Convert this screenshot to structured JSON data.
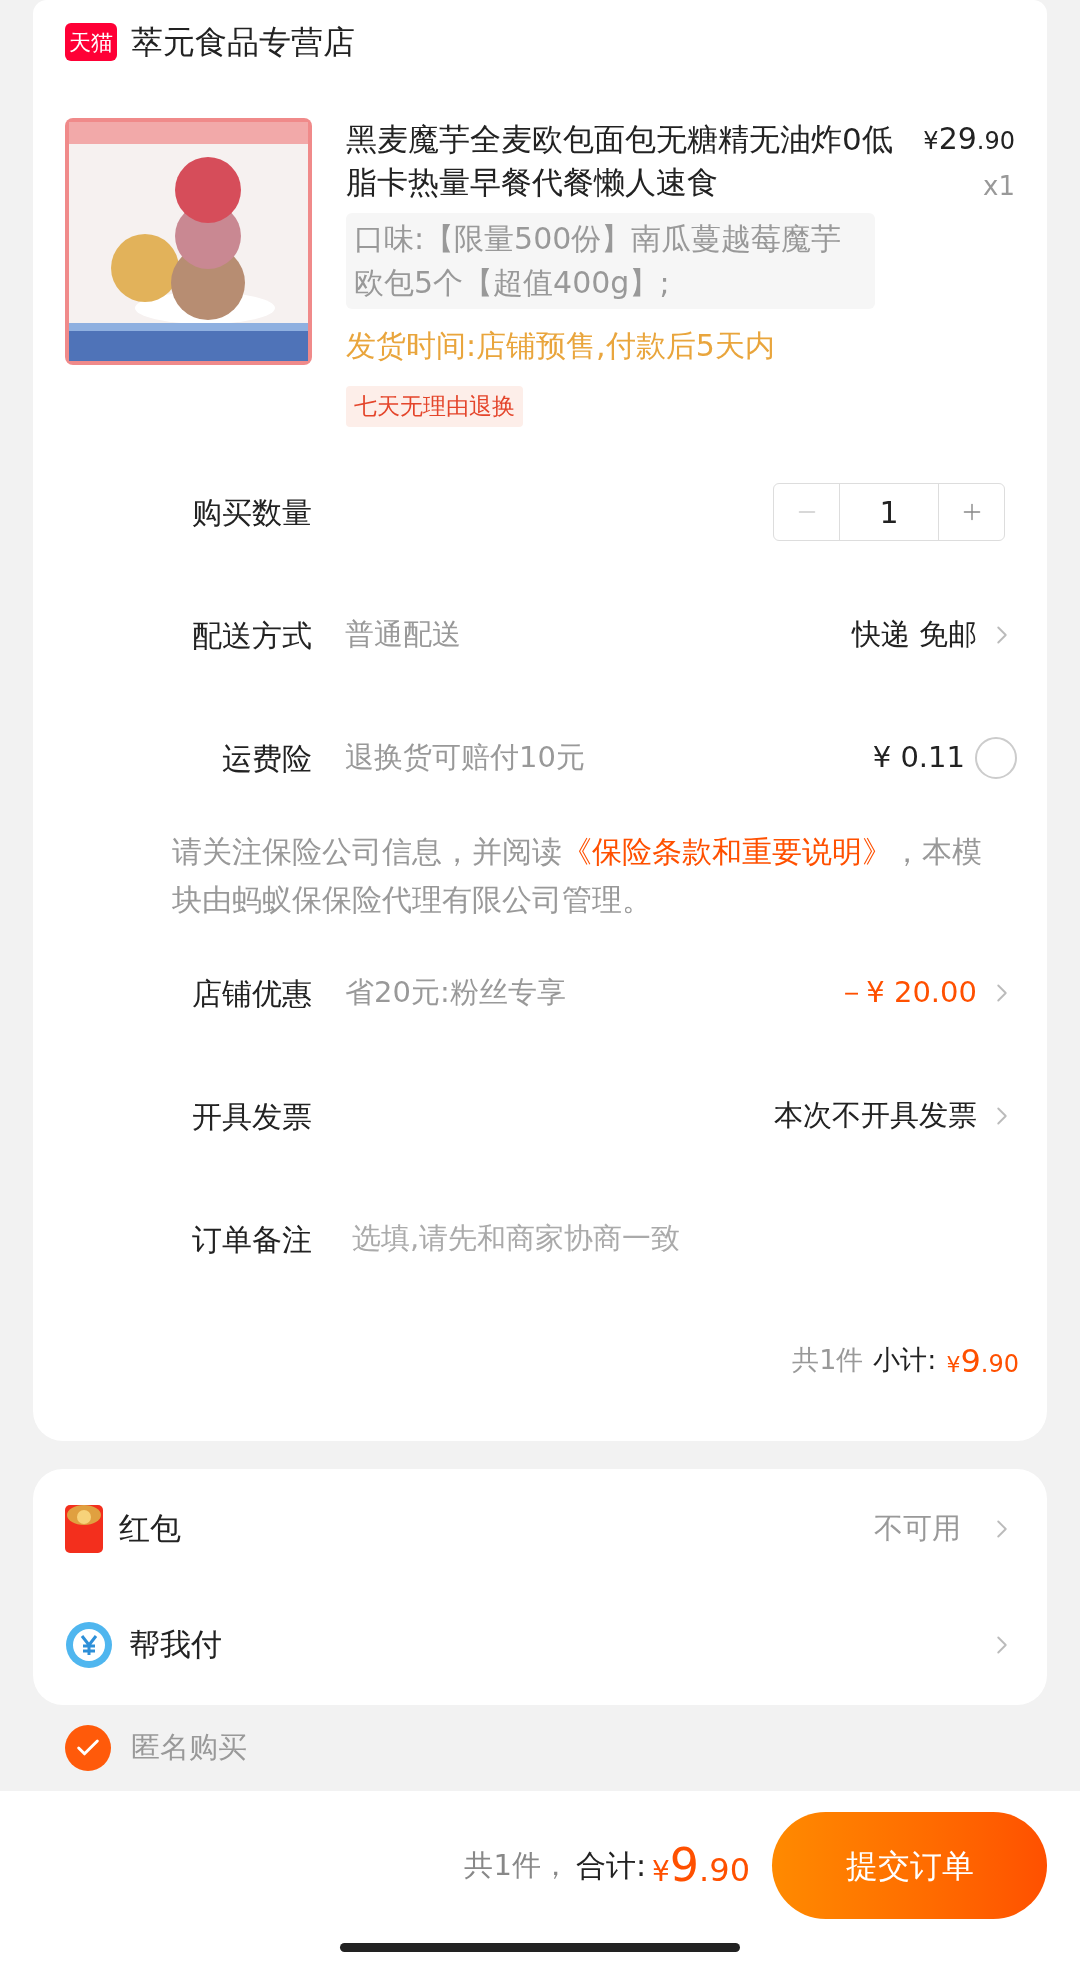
{
  "store": {
    "badge": "天猫",
    "name": "萃元食品专营店"
  },
  "product": {
    "title": "黑麦魔芋全麦欧包面包无糖精无油炸0低脂卡热量早餐代餐懒人速食",
    "price_symbol": "¥",
    "price_int": "29",
    "price_dec": ".90",
    "quantity": "x1",
    "spec": "口味:【限量500份】南瓜蔓越莓魔芋欧包5个【超值400g】;",
    "shipping_time": "发货时间:店铺预售,付款后5天内",
    "tag": "七天无理由退换"
  },
  "quantity_row": {
    "label": "购买数量",
    "value": "1",
    "minus_disabled": true
  },
  "delivery": {
    "label": "配送方式",
    "value": "普通配送",
    "option": "快递 免邮"
  },
  "insurance": {
    "label": "运费险",
    "value": "退换货可赔付10元",
    "price": "¥ 0.11",
    "checked": false
  },
  "notice": {
    "before": "请关注保险公司信息，并阅读",
    "link": "《保险条款和重要说明》",
    "after": "，本模块由蚂蚁保保险代理有限公司管理。"
  },
  "discount": {
    "label": "店铺优惠",
    "value": "省20元:粉丝专享",
    "amount": "－¥ 20.00"
  },
  "invoice": {
    "label": "开具发票",
    "option": "本次不开具发票"
  },
  "remark": {
    "label": "订单备注",
    "placeholder": "选填,请先和商家协商一致"
  },
  "subtotal": {
    "count": "共1件",
    "label": "小计:",
    "symbol": "¥",
    "int": "9",
    "dec": ".90"
  },
  "extras": [
    {
      "kind": "red_packet",
      "label": "红包",
      "value": "不可用"
    },
    {
      "kind": "pay_for_me",
      "label": "帮我付"
    }
  ],
  "anonymous": {
    "label": "匿名购买",
    "checked": true
  },
  "footer": {
    "count": "共1件，",
    "label": "合计:",
    "symbol": "¥",
    "int": "9",
    "dec": ".90",
    "button": "提交订单"
  }
}
